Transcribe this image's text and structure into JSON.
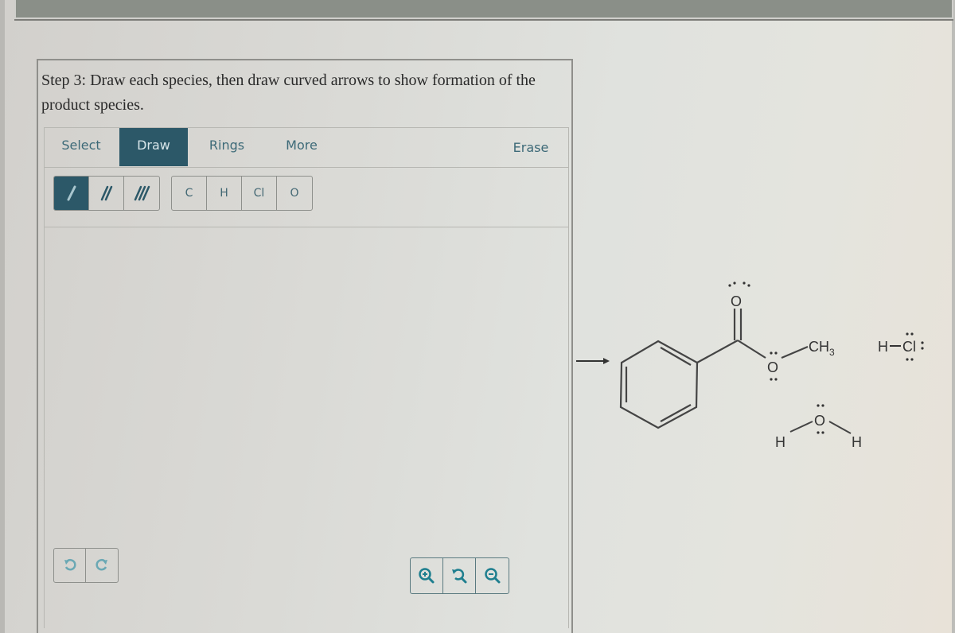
{
  "prompt": {
    "text": "Step 3: Draw each species, then draw curved arrows to show formation of the product species."
  },
  "editor": {
    "tabs": [
      {
        "label": "Select",
        "active": false
      },
      {
        "label": "Draw",
        "active": true
      },
      {
        "label": "Rings",
        "active": false
      },
      {
        "label": "More",
        "active": false
      },
      {
        "label": "Erase",
        "active": false
      }
    ],
    "bond_buttons": [
      {
        "icon": "single-bond-icon",
        "active": true
      },
      {
        "icon": "double-bond-icon",
        "active": false
      },
      {
        "icon": "triple-bond-icon",
        "active": false
      }
    ],
    "atom_buttons": [
      "C",
      "H",
      "Cl",
      "O"
    ],
    "history_buttons": [
      {
        "icon": "undo-icon"
      },
      {
        "icon": "redo-icon"
      }
    ],
    "zoom_buttons": [
      {
        "icon": "zoom-in-icon"
      },
      {
        "icon": "zoom-reset-icon"
      },
      {
        "icon": "zoom-out-icon"
      }
    ]
  },
  "scheme": {
    "labels": {
      "carbonyl_o": "O",
      "ester_o": "O",
      "methyl": "CH",
      "methyl_sub": "3",
      "hcl_h": "H",
      "hcl_cl": "Cl",
      "water_o": "O",
      "water_h1": "H",
      "water_h2": "H"
    },
    "species": [
      "methyl benzoate",
      "HCl",
      "H2O"
    ]
  },
  "colors": {
    "accent": "#2c5868",
    "tab_text": "#3d6a78",
    "icon_teal": "#1f7f8f"
  }
}
